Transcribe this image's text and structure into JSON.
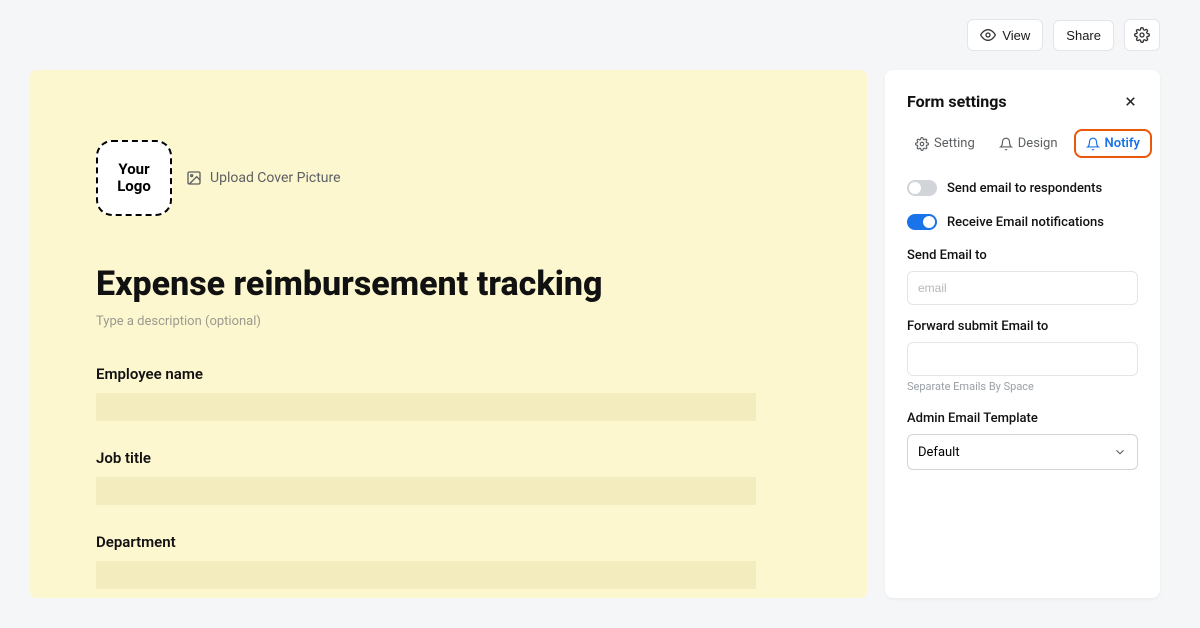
{
  "topbar": {
    "view": "View",
    "share": "Share"
  },
  "form": {
    "logo_line1": "Your",
    "logo_line2": "Logo",
    "upload_cover": "Upload Cover Picture",
    "title": "Expense reimbursement tracking",
    "desc_placeholder": "Type a description (optional)",
    "fields": [
      {
        "label": "Employee name"
      },
      {
        "label": "Job title"
      },
      {
        "label": "Department"
      }
    ]
  },
  "sidebar": {
    "title": "Form settings",
    "tabs": {
      "setting": "Setting",
      "design": "Design",
      "notify": "Notify"
    },
    "toggles": {
      "respondents": "Send email to respondents",
      "receive": "Receive Email notifications"
    },
    "send_to_label": "Send Email to",
    "send_to_placeholder": "email",
    "forward_label": "Forward submit Email to",
    "forward_hint": "Separate Emails By Space",
    "template_label": "Admin Email Template",
    "template_value": "Default"
  }
}
